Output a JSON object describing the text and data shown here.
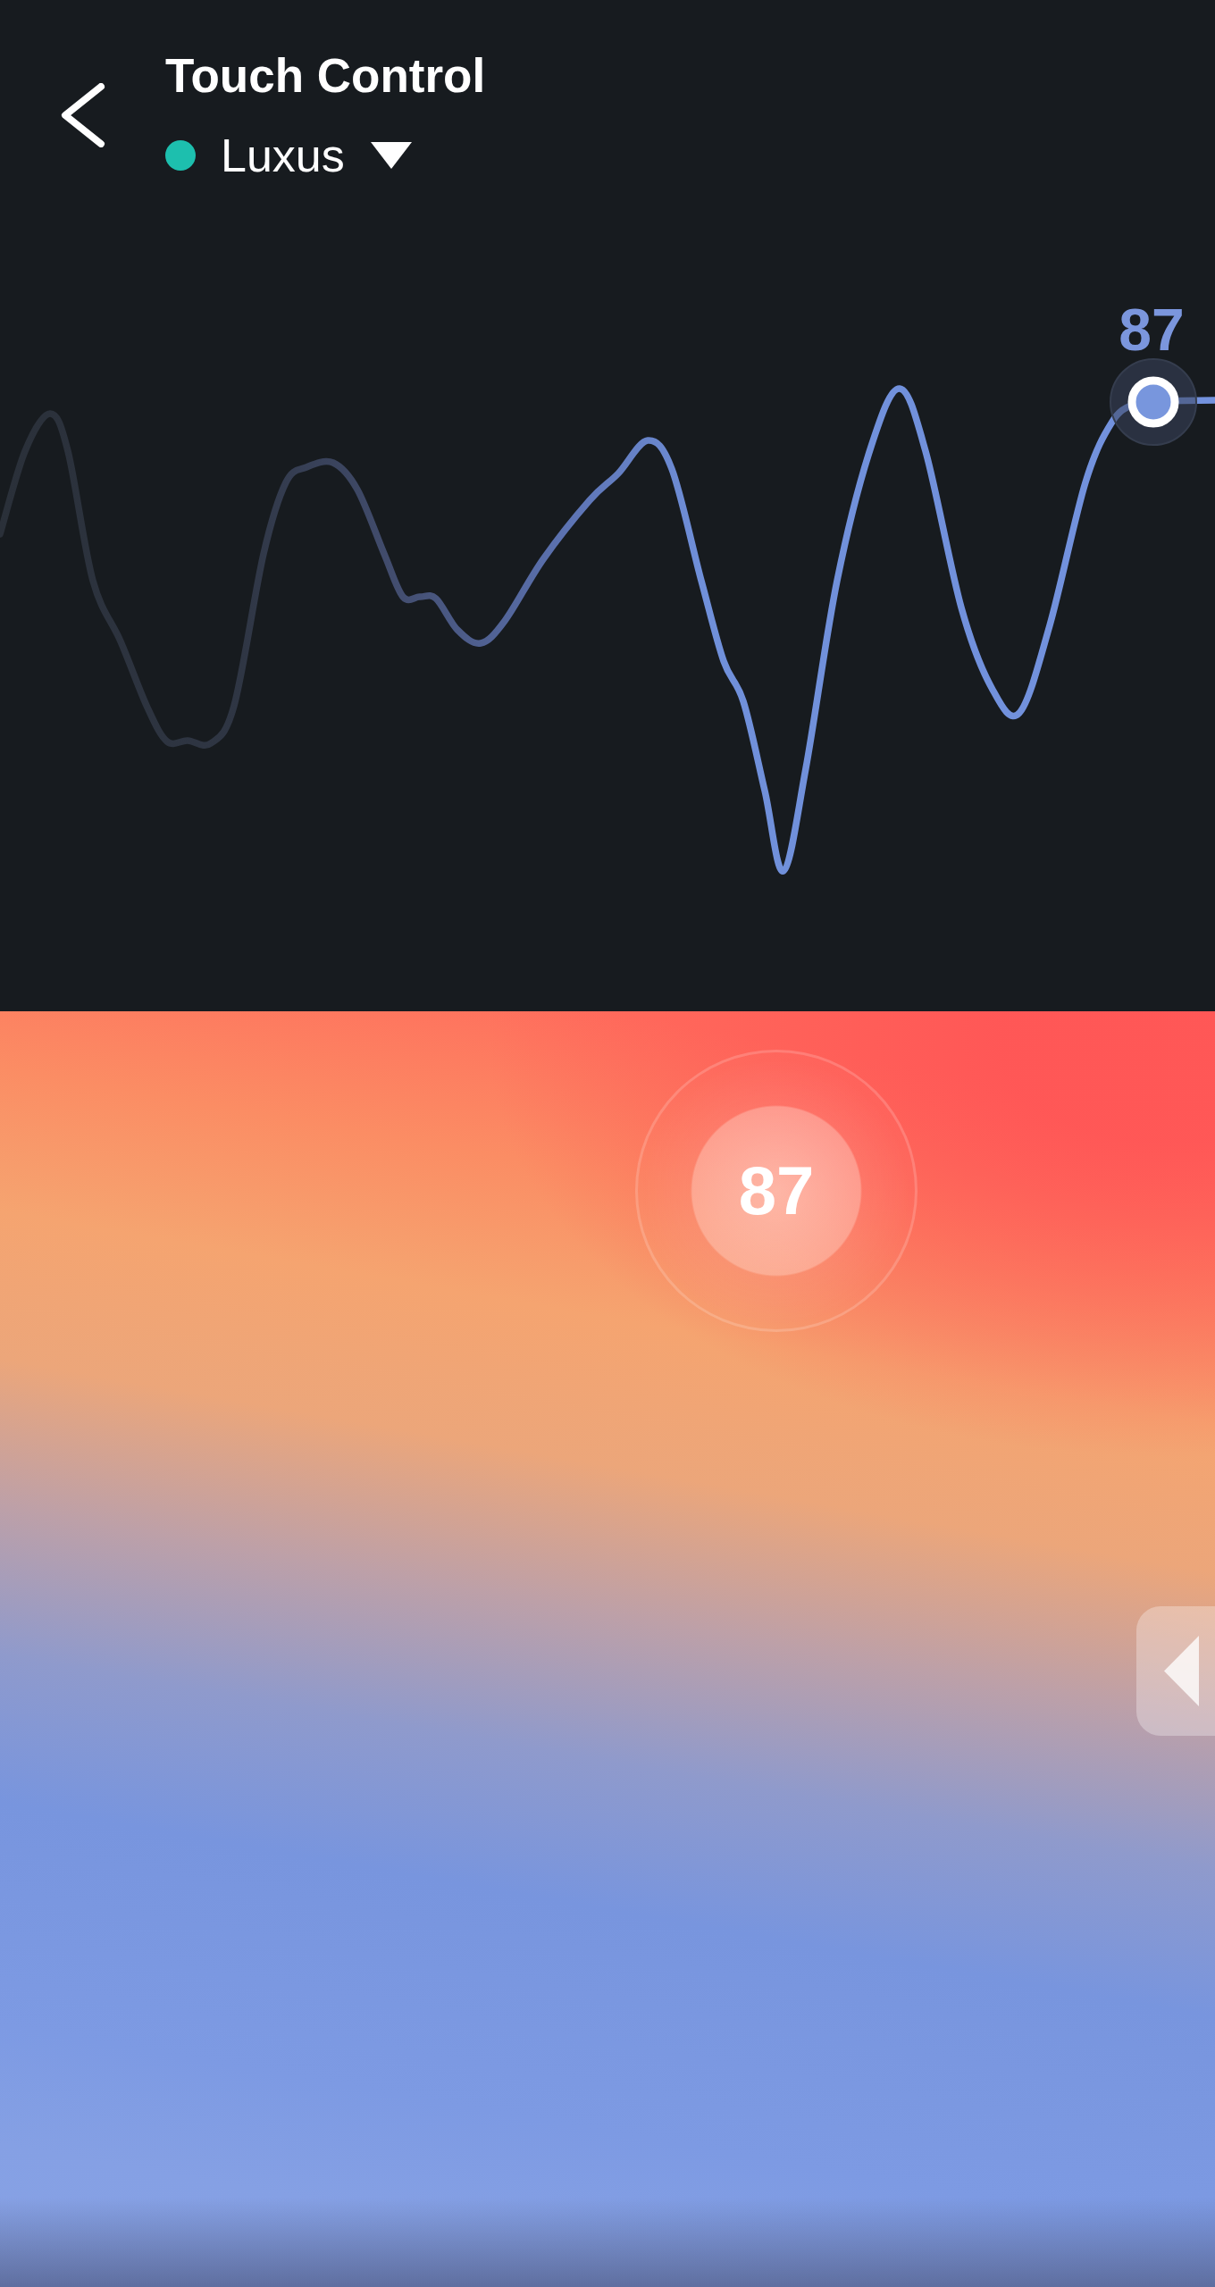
{
  "header": {
    "title": "Touch Control",
    "device": {
      "name": "Luxus",
      "connected": true
    }
  },
  "wave": {
    "value_label": "87"
  },
  "touch_pad": {
    "value": "87"
  }
}
